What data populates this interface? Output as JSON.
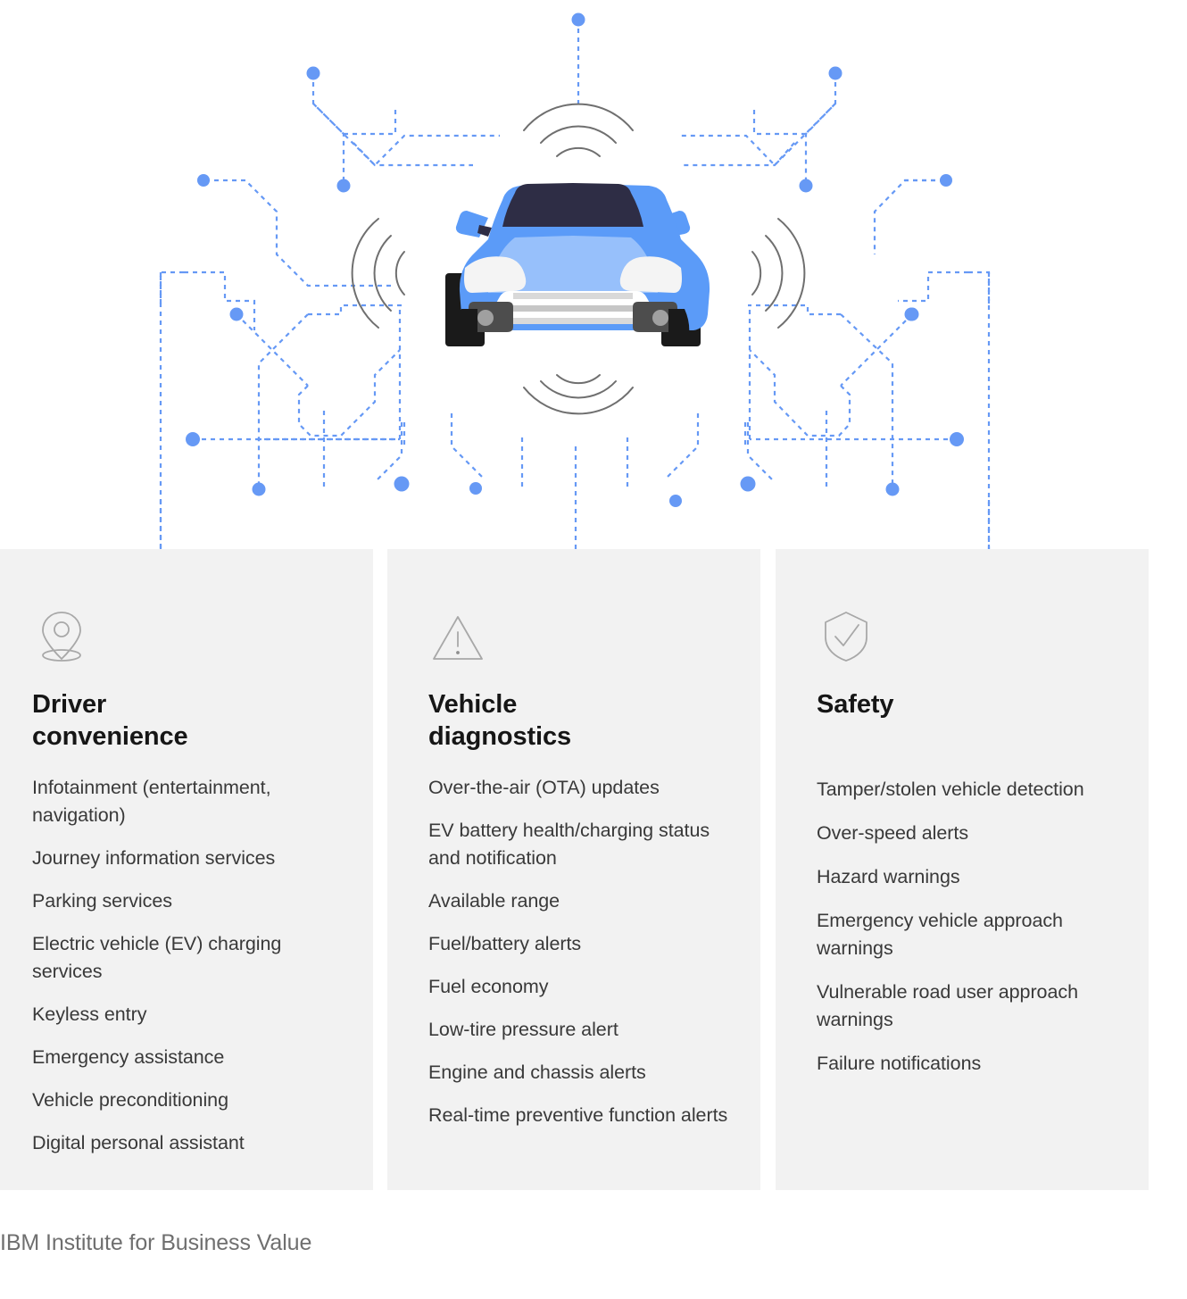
{
  "diagram": {
    "name": "connected-vehicle-diagram",
    "vehicle_icon": "car-front-icon",
    "signal_icon": "wireless-signal-arcs",
    "accent_color": "#6699f5",
    "trace_color": "#6699f5",
    "arc_color": "#6f6f6f",
    "car_body_color": "#5b9bf8",
    "car_hood_color": "#97c0fb",
    "car_window_color": "#2e2d45",
    "car_tire_color": "#1a1a1a",
    "car_grille_color": "#d9d9d9",
    "car_headlight_color": "#f4f4f4"
  },
  "cards": [
    {
      "id": "driver-convenience",
      "icon": "location-pin-icon",
      "title": "Driver\nconvenience",
      "items": [
        "Infotainment (entertainment, navigation)",
        "Journey information services",
        "Parking services",
        "Electric vehicle (EV) charging services",
        "Keyless entry",
        "Emergency assistance",
        "Vehicle preconditioning",
        "Digital personal assistant"
      ]
    },
    {
      "id": "vehicle-diagnostics",
      "icon": "warning-triangle-icon",
      "title": "Vehicle\ndiagnostics",
      "items": [
        "Over-the-air (OTA) updates",
        "EV battery health/charging status and notification",
        "Available range",
        "Fuel/battery alerts",
        "Fuel economy",
        "Low-tire pressure alert",
        "Engine and chassis alerts",
        "Real-time preventive function alerts"
      ]
    },
    {
      "id": "safety",
      "icon": "shield-check-icon",
      "title": "Safety",
      "items": [
        "Tamper/stolen vehicle detection",
        "Over-speed alerts",
        "Hazard warnings",
        "Emergency vehicle approach warnings",
        "Vulnerable road user approach warnings",
        "Failure notifications"
      ]
    }
  ],
  "footer": {
    "source": "IBM Institute for Business Value"
  },
  "colors": {
    "card_background": "#f2f2f2",
    "page_background": "#ffffff",
    "title_color": "#161616",
    "body_color": "#393939",
    "footer_color": "#6f6f6f",
    "icon_stroke": "#a8a8a8"
  }
}
